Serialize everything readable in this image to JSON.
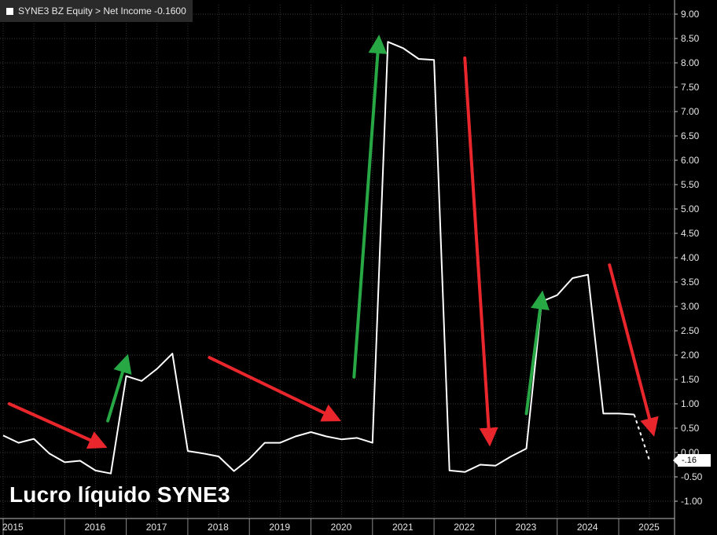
{
  "legend": {
    "label": "SYNE3 BZ Equity > Net Income  -0.1600",
    "swatch_color": "#ffffff"
  },
  "caption": "Lucro líquido SYNE3",
  "last_value_tag": "-.16",
  "chart_data": {
    "type": "line",
    "title": "",
    "xlabel": "",
    "ylabel": "",
    "ylim": [
      -1.25,
      9.1
    ],
    "xlim": [
      2015,
      2025.8
    ],
    "y_axis_side": "right",
    "y_ticks": [
      "9.00",
      "8.50",
      "8.00",
      "7.50",
      "7.00",
      "6.50",
      "6.00",
      "5.50",
      "5.00",
      "4.50",
      "4.00",
      "3.50",
      "3.00",
      "2.50",
      "2.00",
      "1.50",
      "1.00",
      "0.50",
      "0.00",
      "-0.50",
      "-1.00"
    ],
    "x_ticks": [
      "2015",
      "2016",
      "2017",
      "2018",
      "2019",
      "2020",
      "2021",
      "2022",
      "2023",
      "2024",
      "2025"
    ],
    "grid": true,
    "series": [
      {
        "name": "Net Income",
        "color": "#ffffff",
        "style": "solid",
        "x": [
          2015.0,
          2015.25,
          2015.5,
          2015.75,
          2016.0,
          2016.25,
          2016.5,
          2016.75,
          2017.0,
          2017.25,
          2017.5,
          2017.75,
          2018.0,
          2018.25,
          2018.5,
          2018.75,
          2019.0,
          2019.25,
          2019.5,
          2019.75,
          2020.0,
          2020.25,
          2020.5,
          2020.75,
          2021.0,
          2021.25,
          2021.5,
          2021.75,
          2022.0,
          2022.25,
          2022.5,
          2022.75,
          2023.0,
          2023.25,
          2023.5,
          2023.75,
          2024.0,
          2024.25,
          2024.5,
          2024.75,
          2025.0,
          2025.25
        ],
        "y": [
          0.35,
          0.2,
          0.28,
          -0.02,
          -0.2,
          -0.17,
          -0.37,
          -0.43,
          1.57,
          1.47,
          1.72,
          2.03,
          0.03,
          -0.02,
          -0.08,
          -0.38,
          -0.13,
          0.2,
          0.2,
          0.33,
          0.42,
          0.33,
          0.27,
          0.3,
          0.2,
          8.43,
          8.3,
          8.08,
          8.06,
          -0.37,
          -0.4,
          -0.25,
          -0.27,
          -0.08,
          0.08,
          3.1,
          3.23,
          3.58,
          3.65,
          0.8,
          0.8,
          0.78
        ]
      },
      {
        "name": "Net Income (latest)",
        "color": "#ffffff",
        "style": "dashed",
        "x": [
          2025.25,
          2025.5
        ],
        "y": [
          0.78,
          -0.16
        ]
      }
    ],
    "annotations": [
      {
        "type": "arrow",
        "color": "#e8262b",
        "from": [
          2015.1,
          1.0
        ],
        "to": [
          2016.6,
          0.15
        ]
      },
      {
        "type": "arrow",
        "color": "#27a844",
        "from": [
          2016.7,
          0.65
        ],
        "to": [
          2017.0,
          1.9
        ]
      },
      {
        "type": "arrow",
        "color": "#e8262b",
        "from": [
          2018.35,
          1.95
        ],
        "to": [
          2020.4,
          0.7
        ]
      },
      {
        "type": "arrow",
        "color": "#27a844",
        "from": [
          2020.7,
          1.55
        ],
        "to": [
          2021.1,
          8.45
        ]
      },
      {
        "type": "arrow",
        "color": "#e8262b",
        "from": [
          2022.5,
          8.1
        ],
        "to": [
          2022.9,
          0.25
        ]
      },
      {
        "type": "arrow",
        "color": "#27a844",
        "from": [
          2023.5,
          0.8
        ],
        "to": [
          2023.75,
          3.2
        ]
      },
      {
        "type": "arrow",
        "color": "#e8262b",
        "from": [
          2024.85,
          3.85
        ],
        "to": [
          2025.55,
          0.45
        ]
      }
    ]
  }
}
